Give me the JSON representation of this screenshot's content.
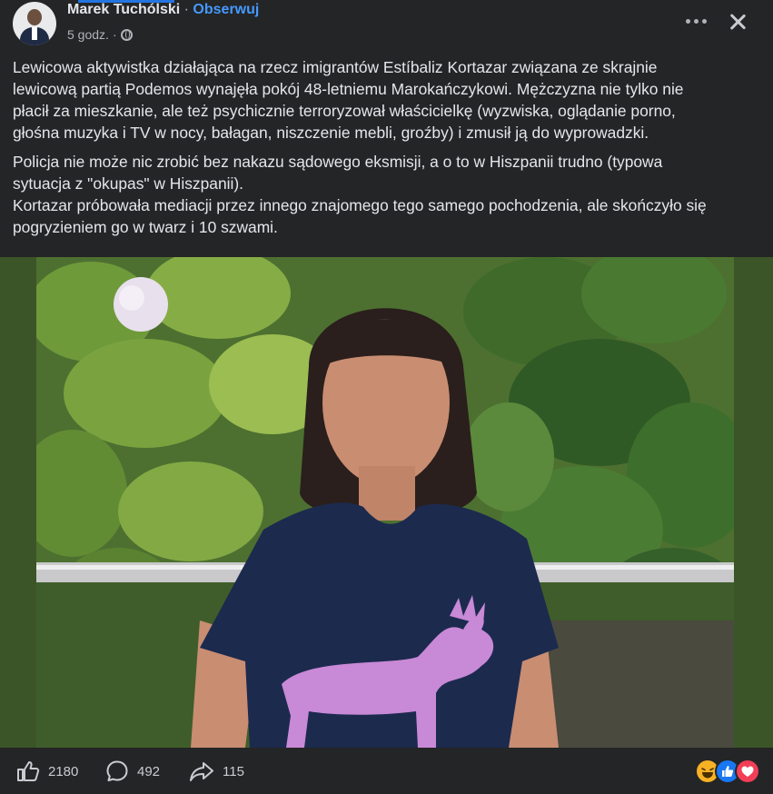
{
  "post": {
    "author": "Marek Tuchólski",
    "separator": "·",
    "follow_label": "Obserwuj",
    "timestamp": "5 godz.",
    "audience_icon": "globe-icon",
    "paragraphs": [
      [
        "Lewicowa aktywistka działająca na rzecz imigrantów Estíbaliz Kortazar związana ze skrajnie",
        "lewicową partią Podemos wynajęła pokój 48-letniemu Marokańczykowi. Mężczyzna nie tylko nie",
        "płacił za mieszkanie, ale też psychicznie terroryzował właścicielkę (wyzwiska, oglądanie porno,",
        "głośna muzyka i TV w nocy, bałagan, niszczenie mebli, groźby) i zmusił ją do wyprowadzki."
      ],
      [
        "Policja nie może nic zrobić bez nakazu sądowego eksmisji, a o to w Hiszpanii trudno (typowa",
        "sytuacja z \"okupas\" w Hiszpanii).",
        "Kortazar próbowała mediacji przez innego znajomego tego samego pochodzenia, ale skończyło się",
        "pogryzieniem go w twarz i 10 szwami."
      ]
    ]
  },
  "footer": {
    "like_count": "2180",
    "comment_count": "492",
    "share_count": "115",
    "reactions": [
      "haha",
      "like",
      "love"
    ]
  },
  "colors": {
    "background": "#242526",
    "text": "#e4e6eb",
    "secondary_text": "#b0b3b8",
    "link": "#4599ff",
    "like_blue": "#1877f2",
    "love_red": "#f33e58",
    "haha_yellow": "#f7b125"
  }
}
